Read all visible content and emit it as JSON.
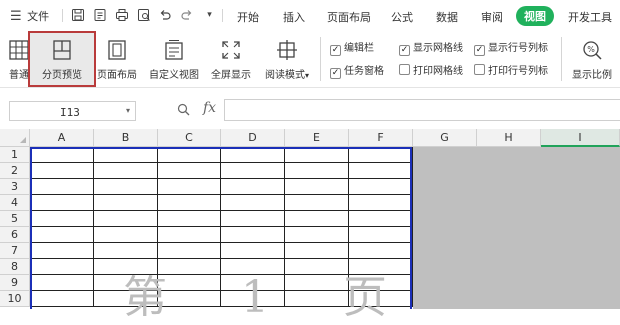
{
  "app": {
    "file_menu_label": "文件",
    "tabs": [
      {
        "label": "开始"
      },
      {
        "label": "插入"
      },
      {
        "label": "页面布局"
      },
      {
        "label": "公式"
      },
      {
        "label": "数据"
      },
      {
        "label": "审阅"
      },
      {
        "label": "视图",
        "active": true
      },
      {
        "label": "开发工具"
      }
    ],
    "quick_access_icons": [
      "save-icon",
      "export-pdf-icon",
      "print-icon",
      "print-preview-icon",
      "undo-icon",
      "redo-icon",
      "customize-dropdown-icon"
    ]
  },
  "ribbon": {
    "buttons": {
      "normal": {
        "label": "普通",
        "icon": "normal-view-icon"
      },
      "page_break_preview": {
        "label": "分页预览",
        "icon": "page-break-preview-icon"
      },
      "page_layout": {
        "label": "页面布局",
        "icon": "page-layout-icon"
      },
      "custom_view": {
        "label": "自定义视图",
        "icon": "custom-view-icon"
      },
      "full_screen": {
        "label": "全屏显示",
        "icon": "full-screen-icon"
      },
      "reading_mode": {
        "label": "阅读模式",
        "icon": "reading-mode-icon"
      },
      "zoom": {
        "label": "显示比例",
        "icon": "zoom-icon"
      }
    },
    "checkboxes": {
      "edit_bar": {
        "label": "编辑栏",
        "checked": true
      },
      "task_pane": {
        "label": "任务窗格",
        "checked": true
      },
      "show_gridlines": {
        "label": "显示网格线",
        "checked": true
      },
      "print_gridlines": {
        "label": "打印网格线",
        "checked": false
      },
      "show_headers": {
        "label": "显示行号列标",
        "checked": true
      },
      "print_headers": {
        "label": "打印行号列标",
        "checked": false
      }
    }
  },
  "formula_bar": {
    "name_box": "I13",
    "fx_label": "fx",
    "formula": ""
  },
  "sheet": {
    "columns": [
      "A",
      "B",
      "C",
      "D",
      "E",
      "F",
      "G",
      "H",
      "I"
    ],
    "selected_column": "I",
    "rows": [
      "1",
      "2",
      "3",
      "4",
      "5",
      "6",
      "7",
      "8",
      "9",
      "10"
    ],
    "page_watermark": "第 1 页"
  },
  "colors": {
    "accent": "#20b15c",
    "print_area_border": "#1b2fb8",
    "highlight_border": "#b93b3b",
    "outside_print_area": "#bfbfbf"
  }
}
